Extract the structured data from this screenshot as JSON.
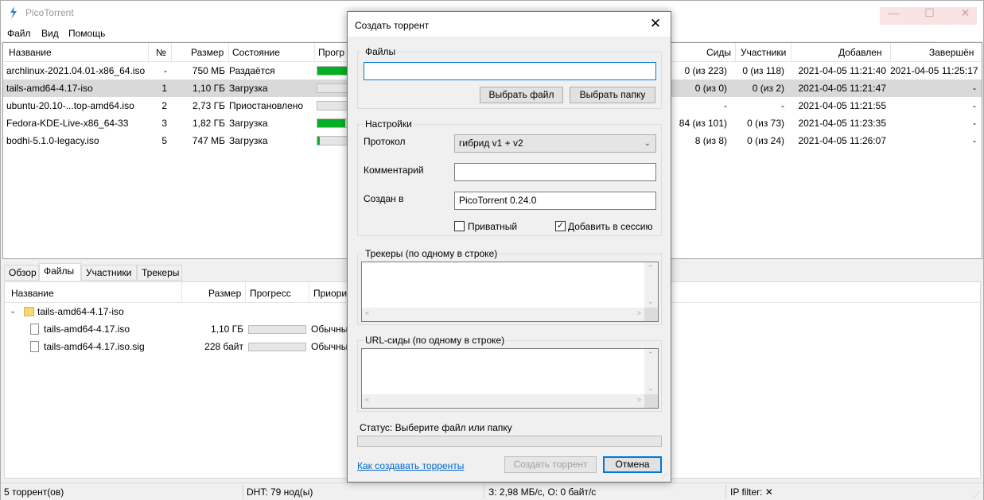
{
  "window": {
    "title": "PicoTorrent",
    "controls": {
      "minimize": "—",
      "maximize": "☐",
      "close": "✕"
    }
  },
  "menu": [
    "Файл",
    "Вид",
    "Помощь"
  ],
  "torrent_list": {
    "columns": [
      "Название",
      "№",
      "Размер",
      "Состояние",
      "Прогр",
      "Сиды",
      "Участники",
      "Добавлен",
      "Завершён"
    ],
    "rows": [
      {
        "name": "archlinux-2021.04.01-x86_64.iso",
        "num": "-",
        "size": "750 МБ",
        "state": "Раздаётся",
        "progress": 1.0,
        "seeds": "0 (из 223)",
        "peers": "0 (из 118)",
        "added": "2021-04-05 11:21:40",
        "completed": "2021-04-05 11:25:17",
        "selected": false
      },
      {
        "name": "tails-amd64-4.17-iso",
        "num": "1",
        "size": "1,10 ГБ",
        "state": "Загрузка",
        "progress": 0.0,
        "seeds": "0 (из 0)",
        "peers": "0 (из 2)",
        "added": "2021-04-05 11:21:47",
        "completed": "-",
        "selected": true
      },
      {
        "name": "ubuntu-20.10-...top-amd64.iso",
        "num": "2",
        "size": "2,73 ГБ",
        "state": "Приостановлено",
        "progress": 0.0,
        "seeds": "-",
        "peers": "-",
        "added": "2021-04-05 11:21:55",
        "completed": "-",
        "selected": false
      },
      {
        "name": "Fedora-KDE-Live-x86_64-33",
        "num": "3",
        "size": "1,82 ГБ",
        "state": "Загрузка",
        "progress": 0.6,
        "seeds": "84 (из 101)",
        "peers": "0 (из 73)",
        "added": "2021-04-05 11:23:35",
        "completed": "-",
        "selected": false
      },
      {
        "name": "bodhi-5.1.0-legacy.iso",
        "num": "5",
        "size": "747 МБ",
        "state": "Загрузка",
        "progress": 0.05,
        "seeds": "8 (из 8)",
        "peers": "0 (из 24)",
        "added": "2021-04-05 11:26:07",
        "completed": "-",
        "selected": false
      }
    ]
  },
  "detail_tabs": [
    "Обзор",
    "Файлы",
    "Участники",
    "Трекеры"
  ],
  "files_pane": {
    "columns": [
      "Название",
      "Размер",
      "Прогресс",
      "Приори"
    ],
    "folder": "tails-amd64-4.17-iso",
    "files": [
      {
        "name": "tails-amd64-4.17.iso",
        "size": "1,10 ГБ",
        "priority": "Обычны"
      },
      {
        "name": "tails-amd64-4.17.iso.sig",
        "size": "228 байт",
        "priority": "Обычны"
      }
    ]
  },
  "statusbar": {
    "torrents": "5 торрент(ов)",
    "dht": "DHT: 79 нод(ы)",
    "speed": "З: 2,98 МБ/с, О: 0 байт/с",
    "ipfilter": "IP filter: ✕"
  },
  "dialog": {
    "title": "Создать торрент",
    "close": "✕",
    "files_group": "Файлы",
    "files_value": "",
    "choose_file": "Выбрать файл",
    "choose_folder": "Выбрать папку",
    "settings_group": "Настройки",
    "protocol_label": "Протокол",
    "protocol_value": "гибрид v1 + v2",
    "comment_label": "Комментарий",
    "comment_value": "",
    "created_by_label": "Создан в",
    "created_by_value": "PicoTorrent 0.24.0",
    "private_label": "Приватный",
    "private_checked": false,
    "add_session_label": "Добавить в сессию",
    "add_session_checked": true,
    "trackers_group": "Трекеры (по одному в строке)",
    "urlseeds_group": "URL-сиды (по одному в строке)",
    "status": "Статус: Выберите файл или папку",
    "status_progress": 0.0,
    "help_link": "Как создавать торренты",
    "create_button": "Создать торрент",
    "cancel_button": "Отмена"
  }
}
